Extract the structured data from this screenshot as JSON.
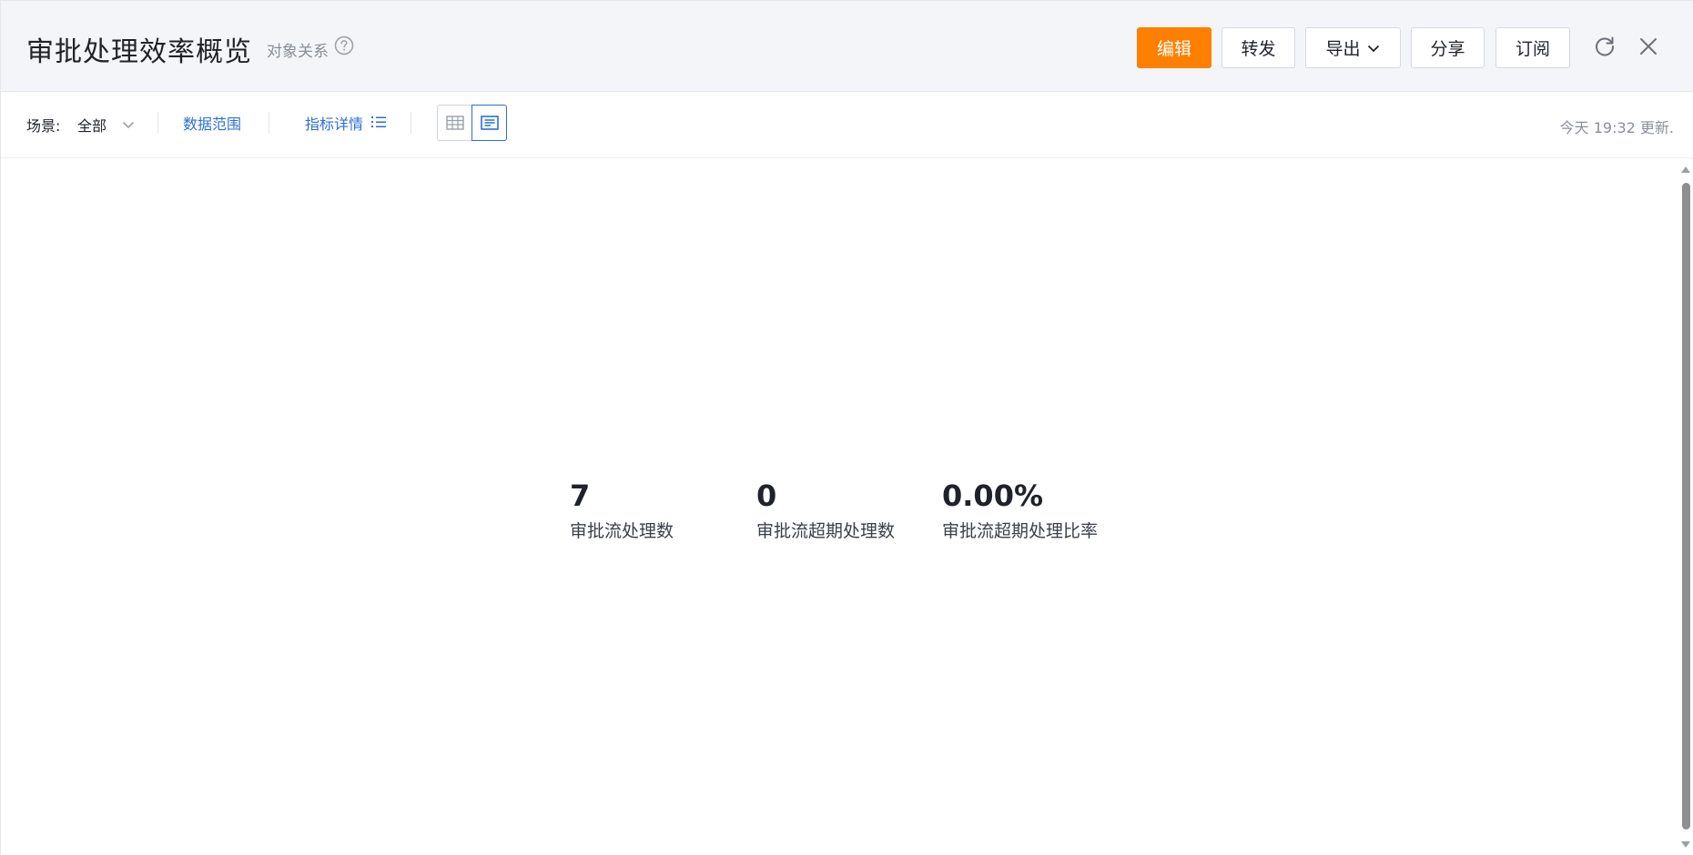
{
  "header": {
    "title": "审批处理效率概览",
    "object_relation": "对象关系",
    "buttons": {
      "edit": "编辑",
      "forward": "转发",
      "export": "导出",
      "share": "分享",
      "subscribe": "订阅"
    },
    "icons": [
      "help-circle-icon",
      "chevron-down-icon",
      "refresh-icon",
      "close-icon"
    ]
  },
  "toolbar": {
    "scene_label": "场景:",
    "scene_value": "全部",
    "data_range": "数据范围",
    "metric_details": "指标详情",
    "updated_text": "今天 19:32 更新.",
    "view_modes": [
      "table-view-icon",
      "card-view-icon"
    ],
    "active_view": "card-view-icon"
  },
  "kpis": [
    {
      "value": "7",
      "label": "审批流处理数"
    },
    {
      "value": "0",
      "label": "审批流超期处理数"
    },
    {
      "value": "0.00%",
      "label": "审批流超期处理比率"
    }
  ],
  "colors": {
    "primary": "#ff8000",
    "link": "#2d6fd6",
    "header_bg": "#f3f5f8"
  }
}
